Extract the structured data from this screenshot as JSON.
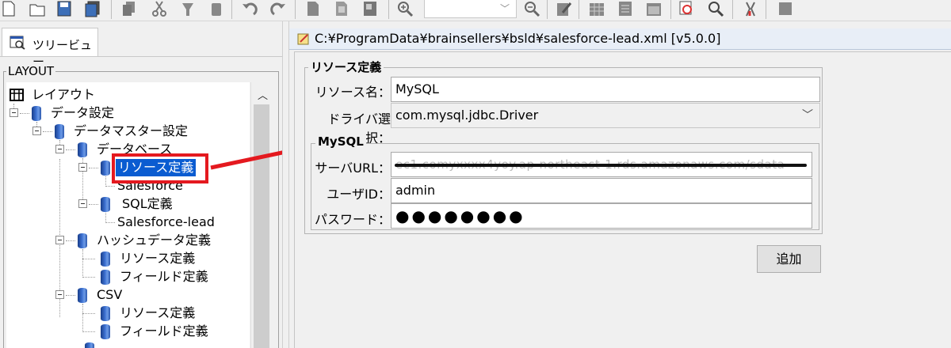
{
  "toolbar": {
    "icons": [
      "new-icon",
      "open-folder-icon",
      "save-icon",
      "save-all-icon",
      "copy-icon",
      "cut-icon",
      "paste-icon",
      "delete-icon",
      "undo-icon",
      "redo-icon",
      "document-icon",
      "document-copy-icon",
      "document-export-icon",
      "zoom-in-icon",
      "zoom-out-icon",
      "edit-icon",
      "grid-icon",
      "table-icon",
      "window-icon",
      "inspect-icon",
      "search-icon",
      "debug-icon",
      "stop-icon"
    ],
    "zoom_value": ""
  },
  "left": {
    "tab_label": "ツリービュー",
    "layout_legend": "LAYOUT",
    "tree": {
      "root": "レイアウト",
      "data_settings": "データ設定",
      "data_master": "データマスター設定",
      "database": "データベース",
      "resource_def": "リソース定義",
      "salesforce": "Salesforce",
      "sql_def": "SQL定義",
      "salesforce_lead": "Salesforce-lead",
      "hash_data": "ハッシュデータ定義",
      "hash_resource": "リソース定義",
      "hash_field": "フィールド定義",
      "csv": "CSV",
      "csv_resource": "リソース定義",
      "csv_field": "フィールド定義"
    }
  },
  "editor": {
    "title": "C:¥ProgramData¥brainsellers¥bsld¥salesforce-lead.xml [v5.0.0]",
    "resource_group": "リソース定義",
    "resource_name_label": "リソース名：",
    "resource_name_value": "MySQL",
    "driver_label": "ドライバ選択：",
    "driver_value": "com.mysql.jdbc.Driver",
    "mysql_group": "MySQL",
    "server_url_label": "サーバURL：",
    "server_url_value": "ec1.comyxxxx4yoy.ap-northeast-1.rds.amazonaws.com/sdata",
    "user_id_label": "ユーザID：",
    "user_id_value": "admin",
    "password_label": "パスワード：",
    "password_value": "●●●●●●●●",
    "add_button": "追加"
  },
  "colors": {
    "selection": "#0a5cd1",
    "annotation_red": "#e4191f",
    "db_icon_blue": "#2a56ad"
  }
}
